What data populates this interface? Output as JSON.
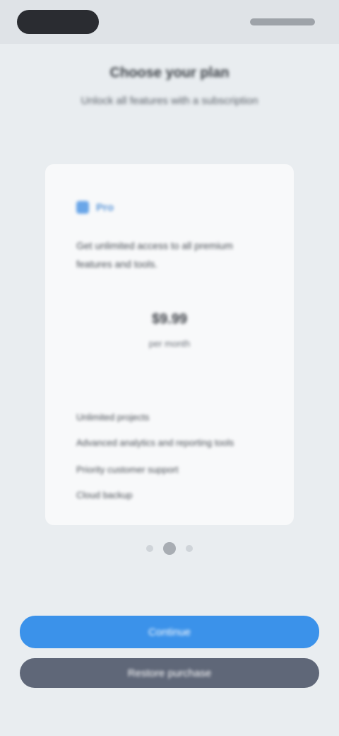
{
  "header": {
    "title": "Choose your plan",
    "subtitle": "Unlock all features with a subscription"
  },
  "plan_card": {
    "badge_label": "Pro",
    "description": "Get unlimited access to all premium features and tools.",
    "price": "$9.99",
    "price_caption": "per month",
    "features": [
      "Unlimited projects",
      "Advanced analytics and reporting tools",
      "Priority customer support",
      "Cloud backup"
    ]
  },
  "actions": {
    "primary_label": "Continue",
    "secondary_label": "Restore purchase"
  },
  "colors": {
    "primary": "#3b92ea",
    "secondary": "#5f6778",
    "background": "#e9edf0"
  }
}
